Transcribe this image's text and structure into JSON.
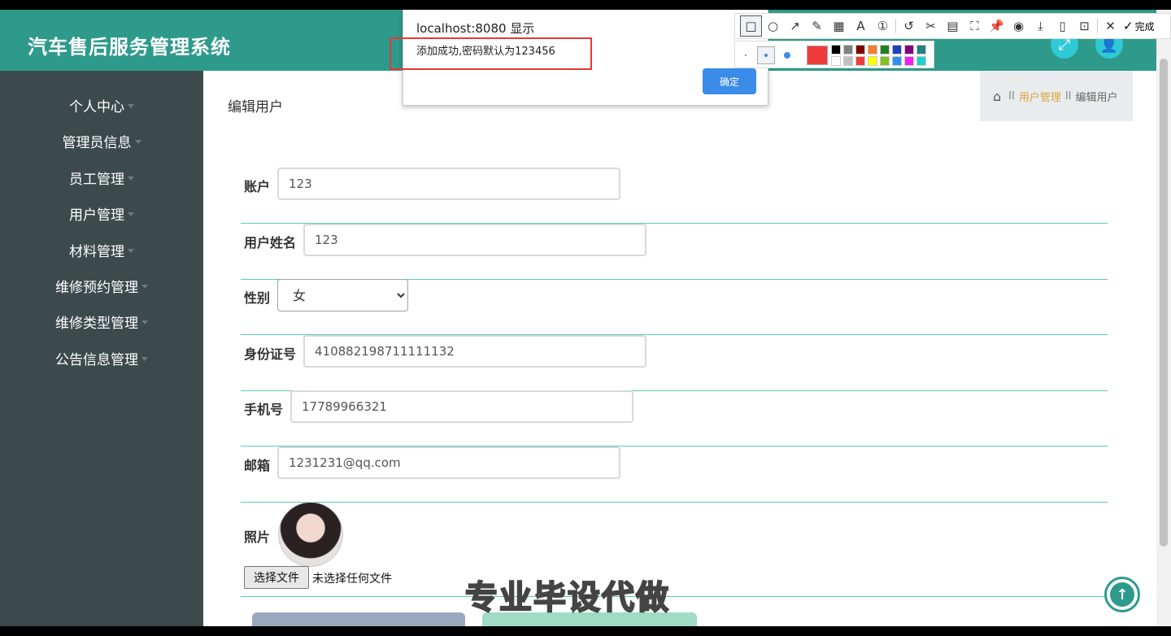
{
  "app": {
    "title": "汽车售后服务管理系统"
  },
  "header": {
    "icons": [
      "expand-icon",
      "user-icon"
    ]
  },
  "sidebar": {
    "items": [
      {
        "label": "个人中心"
      },
      {
        "label": "管理员信息"
      },
      {
        "label": "员工管理"
      },
      {
        "label": "用户管理"
      },
      {
        "label": "材料管理"
      },
      {
        "label": "维修预约管理"
      },
      {
        "label": "维修类型管理"
      },
      {
        "label": "公告信息管理"
      }
    ]
  },
  "page": {
    "title": "编辑用户"
  },
  "breadcrumb": {
    "sep1": "II",
    "link": "用户管理",
    "sep2": "II",
    "current": "编辑用户"
  },
  "form": {
    "account": {
      "label": "账户",
      "value": "123"
    },
    "username": {
      "label": "用户姓名",
      "value": "123"
    },
    "gender": {
      "label": "性别",
      "value": "女"
    },
    "idcard": {
      "label": "身份证号",
      "value": "410882198711111132"
    },
    "phone": {
      "label": "手机号",
      "value": "17789966321"
    },
    "email": {
      "label": "邮箱",
      "value": "1231231@qq.com"
    },
    "photo": {
      "label": "照片",
      "file_button": "选择文件",
      "file_status": "未选择任何文件"
    }
  },
  "dialog": {
    "title": "localhost:8080 显示",
    "message": "添加成功,密码默认为123456",
    "ok_label": "确定"
  },
  "snap_toolbar": {
    "done_label": "完成",
    "current_color": "#f03b3b",
    "palette": [
      "#000000",
      "#808080",
      "#800000",
      "#f08030",
      "#208020",
      "#2040c0",
      "#800080",
      "#208080",
      "#ffffff",
      "#c0c0c0",
      "#f03b3b",
      "#ffff00",
      "#80c020",
      "#3090f0",
      "#f020f0",
      "#20d0d0"
    ]
  },
  "watermark": {
    "text": "专业毕设代做"
  },
  "colors": {
    "header": "#2e9a8b",
    "sidebar": "#3d4a4c",
    "accent": "#5cc9b8"
  }
}
